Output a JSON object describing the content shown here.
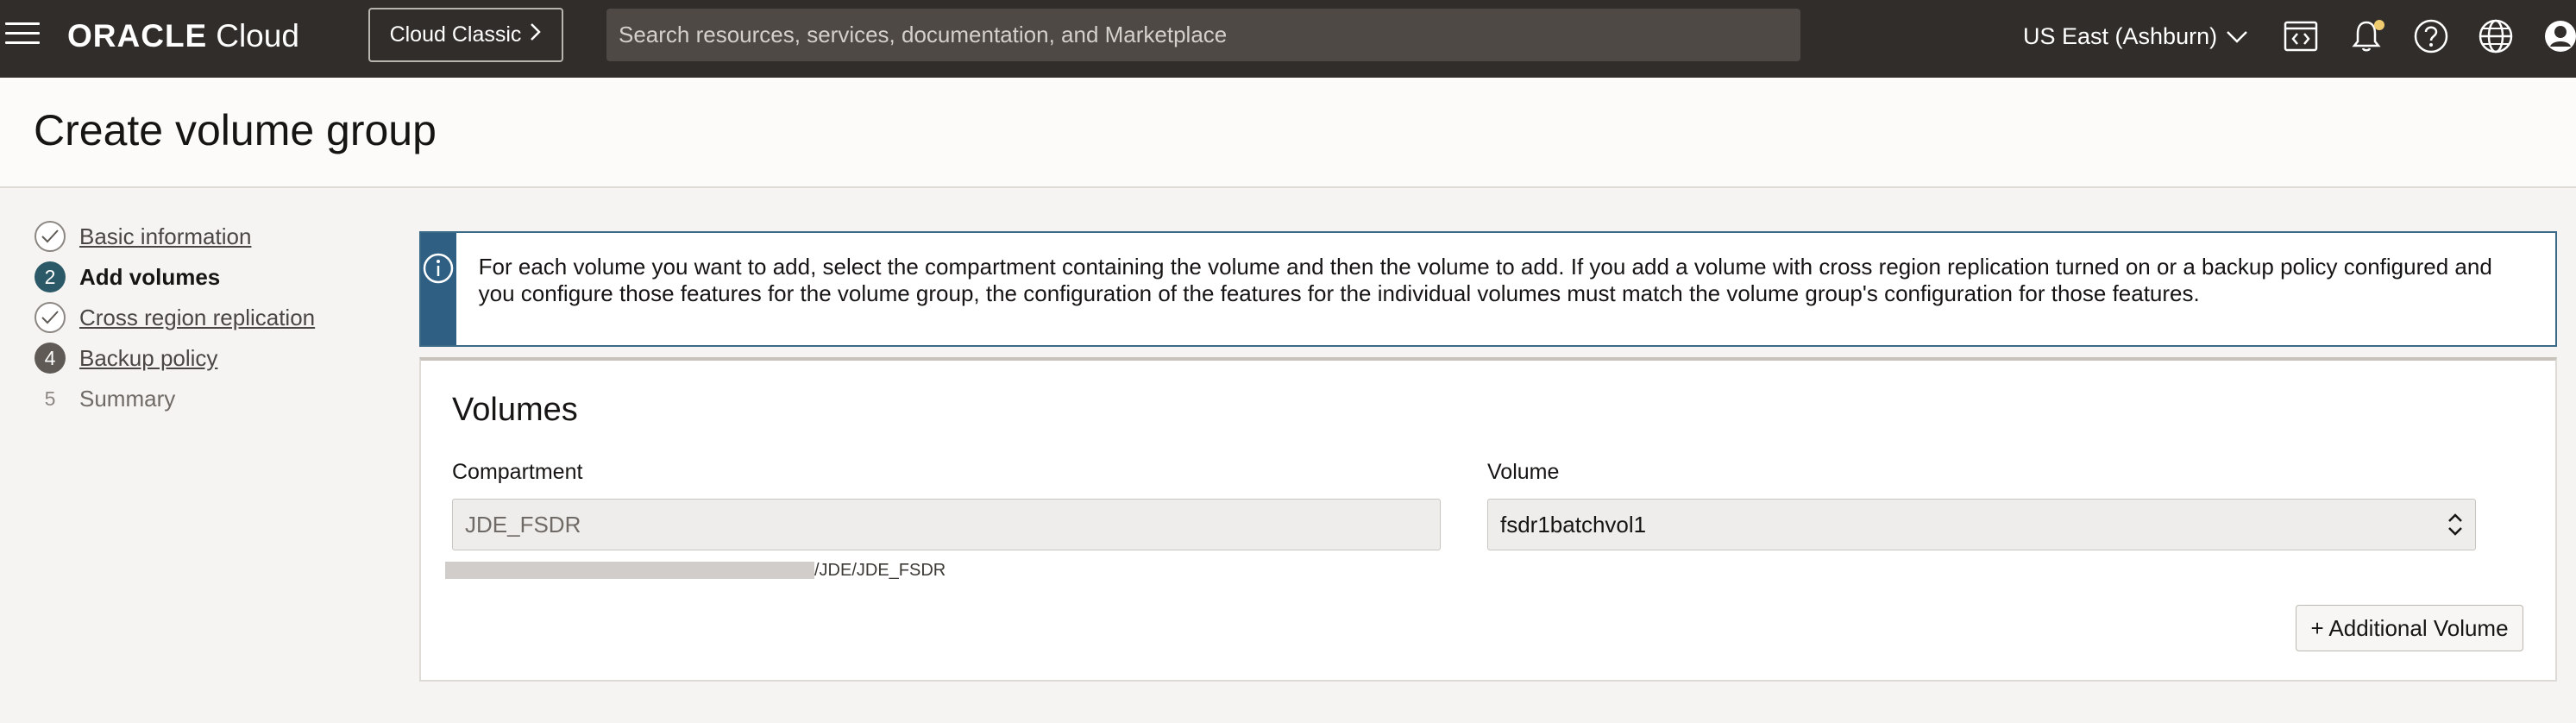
{
  "topbar": {
    "logo_brand": "ORACLE",
    "logo_product": "Cloud",
    "classic_button": "Cloud Classic",
    "search_placeholder": "Search resources, services, documentation, and Marketplace",
    "region": "US East (Ashburn)",
    "icons": [
      "menu-icon",
      "code-editor-icon",
      "bell-icon",
      "help-icon",
      "globe-icon",
      "user-avatar-icon"
    ],
    "accent_color": "#f0cc71"
  },
  "page": {
    "title": "Create volume group"
  },
  "steps": [
    {
      "marker": "",
      "label": "Basic information",
      "state": "done"
    },
    {
      "marker": "2",
      "label": "Add volumes",
      "state": "current"
    },
    {
      "marker": "",
      "label": "Cross region replication",
      "state": "done"
    },
    {
      "marker": "4",
      "label": "Backup policy",
      "state": "visited"
    },
    {
      "marker": "5",
      "label": "Summary",
      "state": "pending"
    }
  ],
  "banner": {
    "text": "For each volume you want to add, select the compartment containing the volume and then the volume to add. If you add a volume with cross region replication turned on or a backup policy configured and you configure those features for the volume group, the configuration of the features for the individual volumes must match the volume group's configuration for those features."
  },
  "volumes": {
    "title": "Volumes",
    "compartment_label": "Compartment",
    "compartment_value": "JDE_FSDR",
    "compartment_path": "/JDE/JDE_FSDR",
    "volume_label": "Volume",
    "volume_value": "fsdr1batchvol1",
    "add_button": "+ Additional Volume"
  },
  "colors": {
    "topbar_bg": "#312d2a",
    "info_accent": "#2f6084",
    "current_step": "#2c5967"
  }
}
